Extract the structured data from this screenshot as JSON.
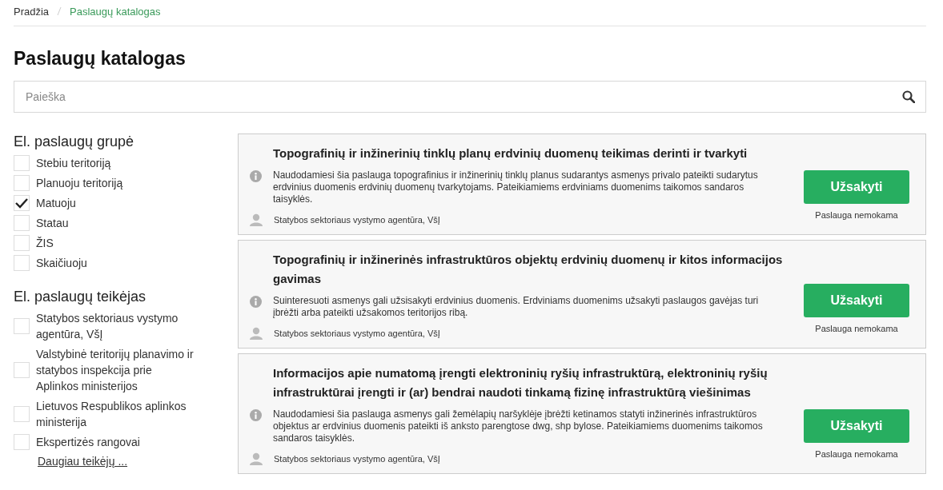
{
  "breadcrumb": [
    {
      "label": "Pradžia",
      "selected": false
    },
    {
      "label": "Paslaugų katalogas",
      "selected": true
    }
  ],
  "title": "Paslaugų katalogas",
  "search": {
    "placeholder": "Paieška"
  },
  "filters": [
    {
      "heading": "El. paslaugų grupė",
      "items": [
        {
          "label": "Stebiu teritoriją",
          "checked": false
        },
        {
          "label": "Planuoju teritoriją",
          "checked": false
        },
        {
          "label": "Matuoju",
          "checked": true
        },
        {
          "label": "Statau",
          "checked": false
        },
        {
          "label": "ŽIS",
          "checked": false
        },
        {
          "label": "Skaičiuoju",
          "checked": false
        }
      ]
    },
    {
      "heading": "El. paslaugų teikėjas",
      "items": [
        {
          "label": "Statybos sektoriaus vystymo agentūra, VšĮ",
          "checked": false
        },
        {
          "label": "Valstybinė teritorijų planavimo ir statybos inspekcija prie Aplinkos ministerijos",
          "checked": false
        },
        {
          "label": "Lietuvos Respublikos aplinkos ministerija",
          "checked": false
        },
        {
          "label": "Ekspertizės rangovai",
          "checked": false
        }
      ],
      "more_link": "Daugiau teikėjų ..."
    }
  ],
  "services": [
    {
      "title": "Topografinių ir inžinerinių tinklų planų erdvinių duomenų teikimas derinti ir tvarkyti",
      "description": "Naudodamiesi šia paslauga topografinius ir inžinerinių tinklų planus sudarantys asmenys privalo pateikti sudarytus erdvinius duomenis erdvinių duomenų tvarkytojams. Pateikiamiems erdviniams duomenims taikomos sandaros taisyklės.",
      "provider": "Statybos sektoriaus vystymo agentūra, VšĮ",
      "button": "Užsakyti",
      "price": "Paslauga nemokama"
    },
    {
      "title": "Topografinių ir inžinerinės infrastruktūros objektų erdvinių duomenų ir kitos informacijos gavimas",
      "description": "Suinteresuoti asmenys gali užsisakyti erdvinius duomenis. Erdviniams duomenims užsakyti paslaugos gavėjas turi įbrėžti arba pateikti užsakomos teritorijos ribą.",
      "provider": "Statybos sektoriaus vystymo agentūra, VšĮ",
      "button": "Užsakyti",
      "price": "Paslauga nemokama"
    },
    {
      "title": "Informacijos apie numatomą įrengti elektroninių ryšių infrastruktūrą, elektroninių ryšių infrastruktūrai įrengti ir (ar) bendrai naudoti tinkamą fizinę infrastruktūrą viešinimas",
      "description": "Naudodamiesi šia paslauga asmenys gali žemėlapių naršyklėje įbrėžti ketinamos statyti inžinerinės infrastruktūros objektus ar erdvinius duomenis pateikti iš anksto parengtose dwg, shp bylose. Pateikiamiems duomenims taikomos sandaros taisyklės.",
      "provider": "Statybos sektoriaus vystymo agentūra, VšĮ",
      "button": "Užsakyti",
      "price": "Paslauga nemokama"
    }
  ]
}
